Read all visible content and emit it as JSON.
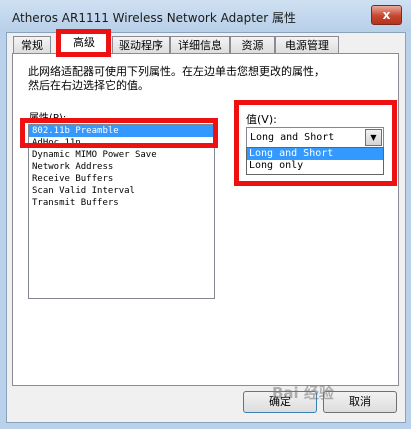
{
  "window": {
    "title": "Atheros AR1111 Wireless Network Adapter 属性",
    "close_symbol": "x"
  },
  "tabs": [
    {
      "label": "常规",
      "active": false
    },
    {
      "label": "高级",
      "active": true
    },
    {
      "label": "驱动程序",
      "active": false
    },
    {
      "label": "详细信息",
      "active": false
    },
    {
      "label": "资源",
      "active": false
    },
    {
      "label": "电源管理",
      "active": false
    }
  ],
  "advanced": {
    "description_lines": [
      "此网络适配器可使用下列属性。在左边单击您想更改的属性，",
      "然后在右边选择它的值。"
    ],
    "property_label": "属性(P):",
    "properties": [
      {
        "label": "802.11b Preamble",
        "selected": true
      },
      {
        "label": "AdHoc 11n",
        "selected": false
      },
      {
        "label": "Dynamic MIMO Power Save",
        "selected": false
      },
      {
        "label": "Network Address",
        "selected": false
      },
      {
        "label": "Receive Buffers",
        "selected": false
      },
      {
        "label": "Scan Valid Interval",
        "selected": false
      },
      {
        "label": "Transmit Buffers",
        "selected": false
      }
    ],
    "value_label": "值(V):",
    "value_selected": "Long and Short",
    "value_options": [
      {
        "label": "Long and Short",
        "selected": true
      },
      {
        "label": "Long only",
        "selected": false
      }
    ]
  },
  "buttons": {
    "ok": "确定",
    "cancel": "取消"
  },
  "watermark": "Bai 经验",
  "colors": {
    "highlight_box": "#ee1111",
    "selection": "#3399ff",
    "title_bar": "#b9d1ea"
  }
}
